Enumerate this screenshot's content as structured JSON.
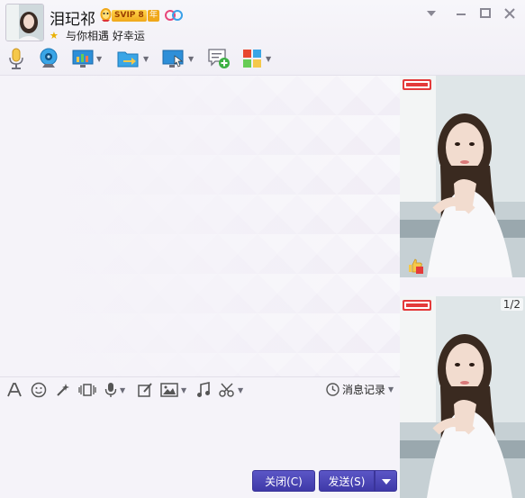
{
  "contact": {
    "name": "泪玘祁",
    "vip_label": "SVIP 8",
    "year_label": "年",
    "signature": "与你相遇 好幸运"
  },
  "toolbar": {
    "icons": [
      "microphone-icon",
      "video-call-icon",
      "screen-share-icon",
      "file-transfer-icon",
      "remote-desktop-icon",
      "new-message-icon",
      "apps-icon"
    ]
  },
  "input_toolbar": {
    "history_label": "消息记录"
  },
  "buttons": {
    "close_label": "关闭(C)",
    "send_label": "发送(S)"
  },
  "photo_panel": {
    "page_indicator": "1/2"
  },
  "colors": {
    "accent": "#4a43b5",
    "background": "#f4f2f8"
  }
}
